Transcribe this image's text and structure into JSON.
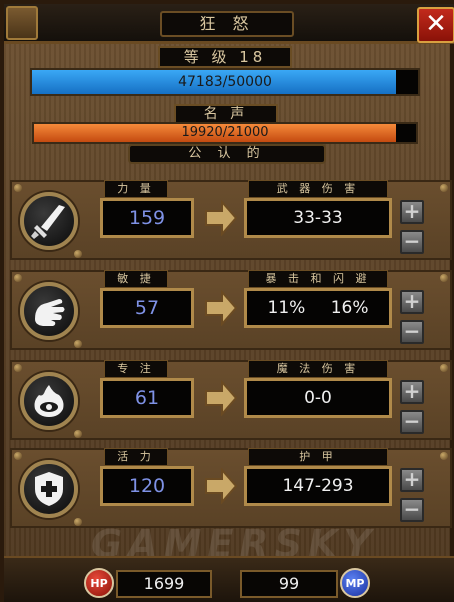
{
  "window": {
    "title": "狂 怒"
  },
  "level": {
    "label": "等 级 18",
    "xp_text": "47183/50000",
    "xp_progress": 0.9437
  },
  "fame": {
    "label": "名 声",
    "text": "19920/21000",
    "progress": 0.9486,
    "rank": "公 认 的"
  },
  "stats": [
    {
      "icon": "sword-icon",
      "stat_label": "力 量",
      "stat_value": "159",
      "result_label": "武 器 伤 害",
      "result_values": [
        "33-33"
      ]
    },
    {
      "icon": "fist-icon",
      "stat_label": "敏 捷",
      "stat_value": "57",
      "result_label": "暴 击 和 闪 避",
      "result_values": [
        "11%",
        "16%"
      ]
    },
    {
      "icon": "eye-flame-icon",
      "stat_label": "专 注",
      "stat_value": "61",
      "result_label": "魔 法 伤 害",
      "result_values": [
        "0-0"
      ]
    },
    {
      "icon": "shield-cross-icon",
      "stat_label": "活 力",
      "stat_value": "120",
      "result_label": "护 甲",
      "result_values": [
        "147-293"
      ]
    }
  ],
  "buttons": {
    "plus": "+",
    "minus": "−",
    "close": "✕"
  },
  "bottom": {
    "hp_label": "HP",
    "hp_value": "1699",
    "mp_label": "MP",
    "mp_value": "99"
  },
  "watermark": "GAMERSKY",
  "colors": {
    "xp_bar": "#1e90e6",
    "fame_bar": "#e8661a",
    "stat_value": "#7f92e6",
    "hp_orb": "#c0201a",
    "mp_orb": "#2a50c8"
  }
}
